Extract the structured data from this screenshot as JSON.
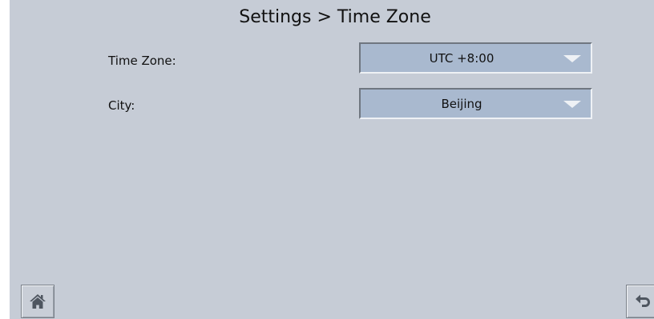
{
  "header": {
    "title": "Settings > Time Zone"
  },
  "settings": {
    "timezone": {
      "label": "Time Zone:",
      "value": "UTC +8:00"
    },
    "city": {
      "label": "City:",
      "value": "Beijing"
    }
  },
  "footer": {
    "home_icon": "home-icon",
    "back_icon": "back-arrow-icon"
  },
  "colors": {
    "background": "#c6ccd6",
    "dropdown": "#a9b9cf",
    "caret": "#eef1f5",
    "icon": "#4f5660"
  }
}
